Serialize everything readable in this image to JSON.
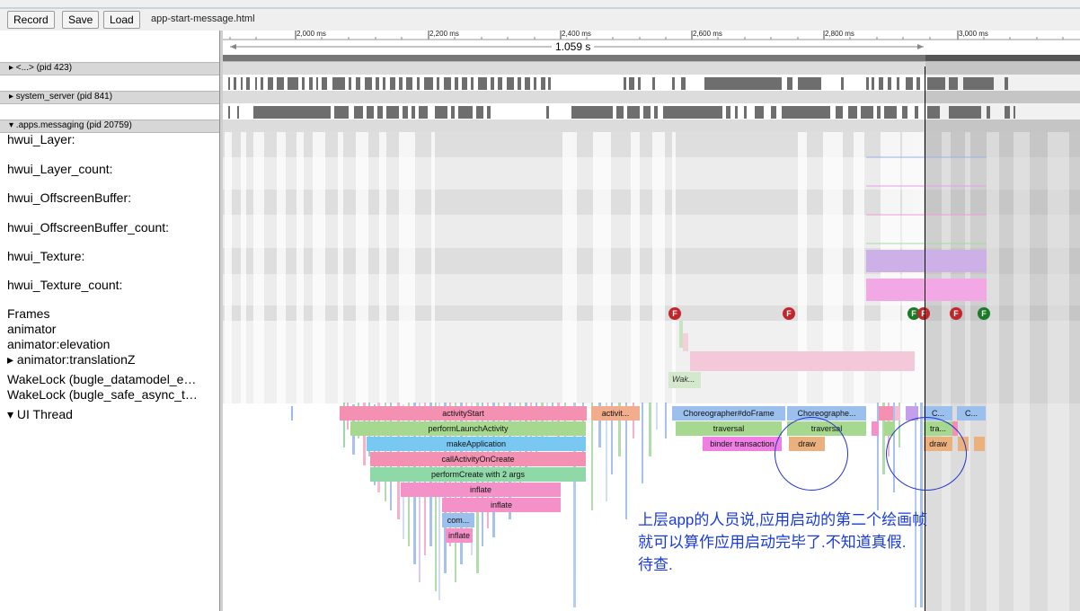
{
  "toolbar": {
    "record_label": "Record",
    "save_label": "Save",
    "load_label": "Load",
    "filename": "app-start-message.html"
  },
  "ruler": {
    "ticks": [
      "2,000 ms",
      "2,200 ms",
      "2,400 ms",
      "2,600 ms",
      "2,800 ms",
      "3,000 ms"
    ],
    "selection_duration": "1.059 s"
  },
  "processes": [
    {
      "label": "▸ <...> (pid 423)"
    },
    {
      "label": "▸ system_server (pid 841)"
    },
    {
      "label": "▾ .apps.messaging (pid 20759)"
    }
  ],
  "tracks": [
    {
      "label": "hwui_Layer:"
    },
    {
      "label": "hwui_Layer_count:"
    },
    {
      "label": "hwui_OffscreenBuffer:"
    },
    {
      "label": "hwui_OffscreenBuffer_count:"
    },
    {
      "label": "hwui_Texture:"
    },
    {
      "label": "hwui_Texture_count:"
    },
    {
      "label": "Frames"
    },
    {
      "label": "animator"
    },
    {
      "label": "animator:elevation"
    },
    {
      "label": "▸ animator:translationZ"
    },
    {
      "label": "WakeLock (bugle_datamodel_e…"
    },
    {
      "label": "WakeLock (bugle_safe_async_t…"
    },
    {
      "label": "▾ UI Thread"
    }
  ],
  "slices": {
    "activityStart": "activityStart",
    "activit": "activit...",
    "choreo1": "Choreographer#doFrame",
    "choreo2": "Choreographe...",
    "c1": "C...",
    "c2": "C...",
    "performLaunchActivity": "performLaunchActivity",
    "traversal1": "traversal",
    "traversal2": "traversal",
    "tra": "tra...",
    "makeApplication": "makeApplication",
    "binder": "binder transaction",
    "draw1": "draw",
    "draw2": "draw",
    "callActivityOnCreate": "callActivityOnCreate",
    "performCreate": "performCreate with 2 args",
    "inflate1": "inflate",
    "inflate2": "inflate",
    "com": "com...",
    "inflate3": "inflate",
    "wak": "Wak..."
  },
  "frame_marker": "F",
  "annotation": {
    "line1": "上层app的人员说,应用启动的第二个绘画帧",
    "line2": "就可以算作应用启动完毕了.不知道真假.",
    "line3": "待查."
  },
  "colors": {
    "frame_red": "#c0272d",
    "frame_green": "#1b7a28",
    "annotation": "#1a3cd6"
  }
}
